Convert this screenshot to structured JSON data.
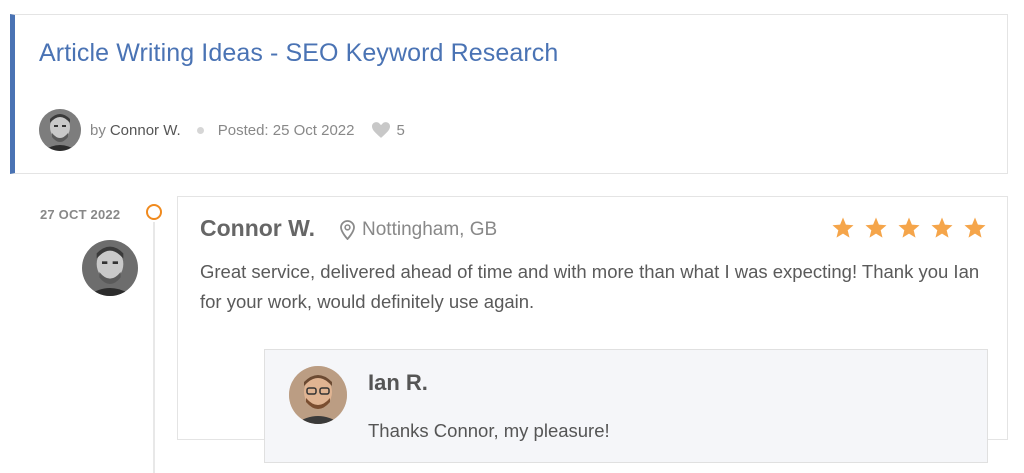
{
  "post": {
    "title": "Article Writing Ideas - SEO Keyword Research",
    "by_label": "by",
    "author": "Connor W.",
    "posted": "Posted: 25 Oct 2022",
    "likes": "5",
    "heart_icon": "heart-icon"
  },
  "review": {
    "date": "27 OCT 2022",
    "reviewer": "Connor W.",
    "location": "Nottingham, GB",
    "location_icon": "map-pin-icon",
    "rating": 5,
    "max_rating": 5,
    "star_color": "#f5a54a",
    "text": "Great service, delivered ahead of time and with more than what I was expecting! Thank you Ian for your work, would definitely use again."
  },
  "reply": {
    "name": "Ian R.",
    "text": "Thanks Connor, my pleasure!"
  },
  "colors": {
    "accent": "#4a73b4",
    "timeline_dot": "#f08a1e"
  }
}
